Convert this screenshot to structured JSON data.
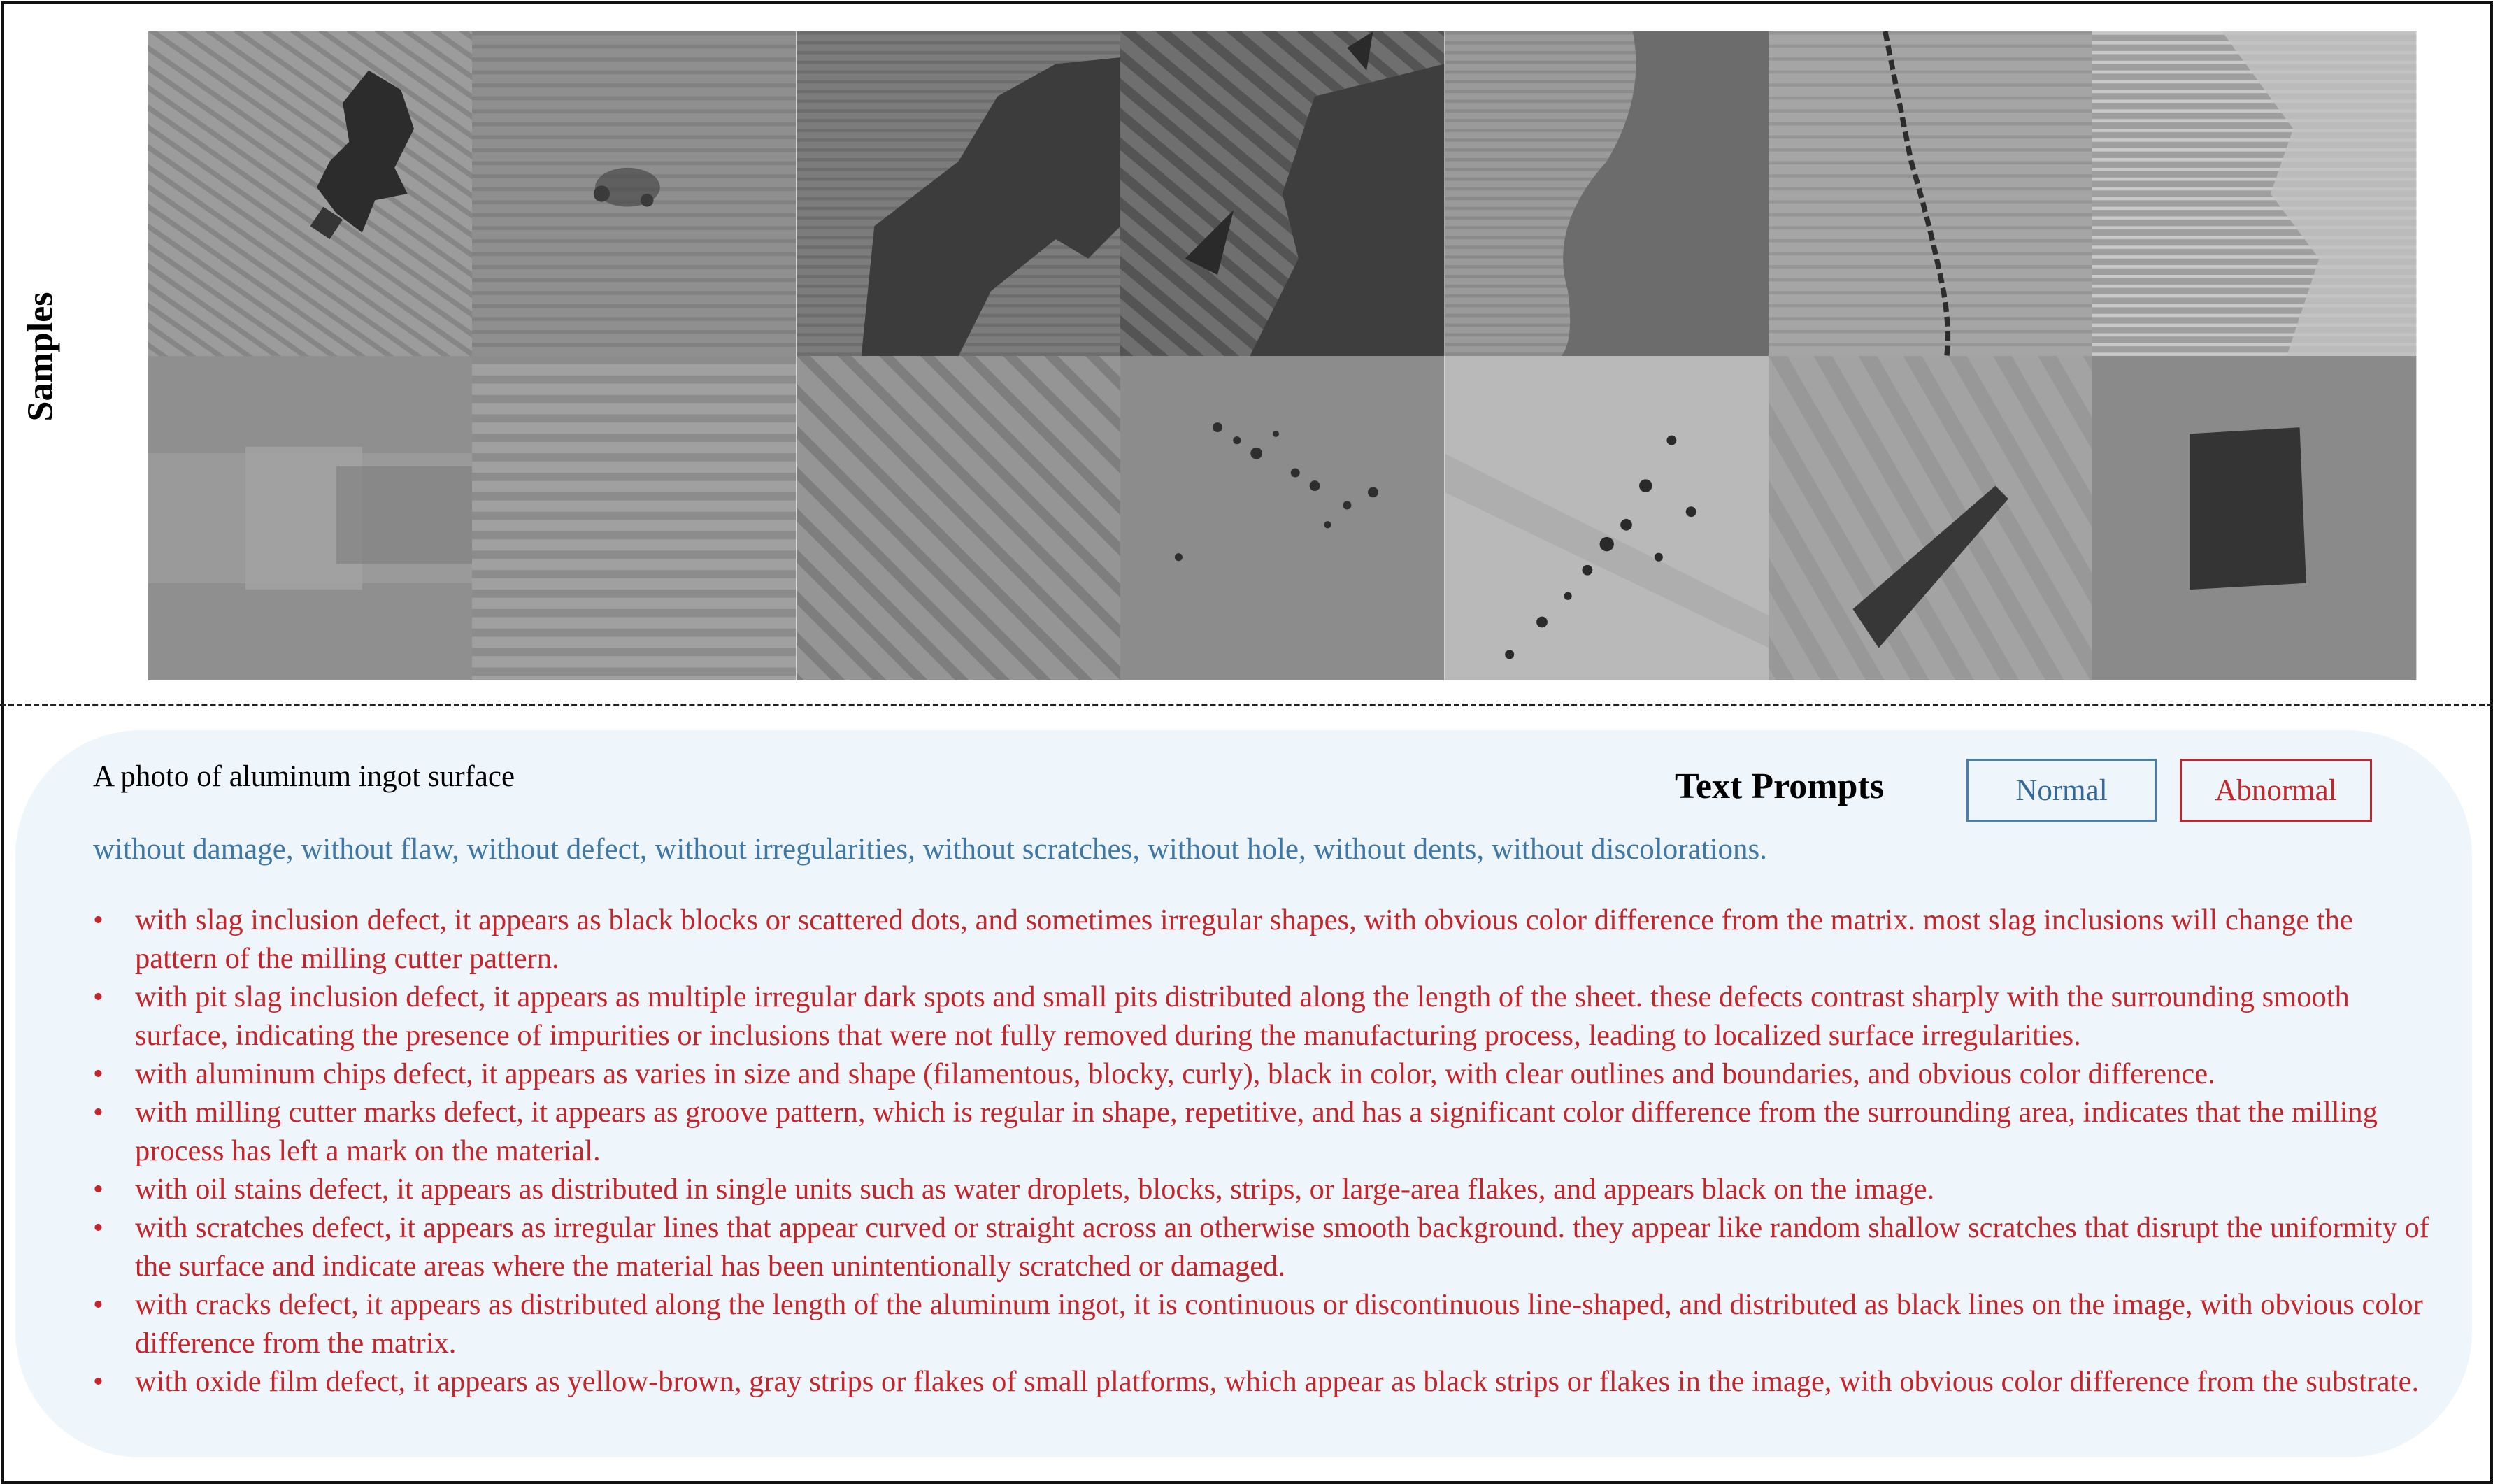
{
  "samples_label": "Samples",
  "prompt_prefix": "A photo of aluminum ingot surface",
  "text_prompts_title": "Text Prompts",
  "legend": {
    "normal": "Normal",
    "abnormal": "Abnormal"
  },
  "normal_prompt": "without damage, without flaw, without defect, without irregularities, without scratches, without hole, without dents, without discolorations.",
  "abnormal_prompts": [
    "with slag inclusion defect, it appears as black blocks or scattered dots, and sometimes irregular shapes, with obvious color difference from the matrix. most slag inclusions will change the pattern of the milling cutter pattern.",
    "with pit slag inclusion defect, it appears as multiple irregular dark spots and small pits distributed along the length of the sheet. these defects contrast sharply with the surrounding smooth surface, indicating the presence of impurities or inclusions that were not fully removed during the manufacturing process, leading to localized surface irregularities.",
    "with aluminum chips defect, it appears as varies in size and shape (filamentous, blocky, curly), black in color, with clear outlines and boundaries, and obvious color difference.",
    "with milling cutter marks defect, it appears as groove pattern, which is regular in shape, repetitive, and has a significant color difference from the surrounding area, indicates that the milling process has left a mark on the material.",
    "with oil stains defect, it appears as distributed in single units such as water droplets, blocks, strips, or large-area flakes, and appears black on the image.",
    "with scratches defect, it appears as irregular lines that appear curved or straight across an otherwise smooth background. they appear like random shallow scratches that disrupt the uniformity of the surface and indicate areas where the material has been unintentionally scratched or damaged.",
    "with cracks defect, it appears as distributed along the length of the aluminum ingot, it is continuous or discontinuous line-shaped, and distributed as black lines on the image, with obvious color difference from the matrix.",
    "with oxide film defect, it appears as yellow-brown, gray strips or flakes of small platforms, which appear as black strips or flakes in the image, with obvious color difference from the substrate."
  ],
  "bullet_glyph": "•",
  "colors": {
    "normal": "#3f77a6",
    "abnormal": "#c4252b",
    "panel": "#eef5fb"
  }
}
